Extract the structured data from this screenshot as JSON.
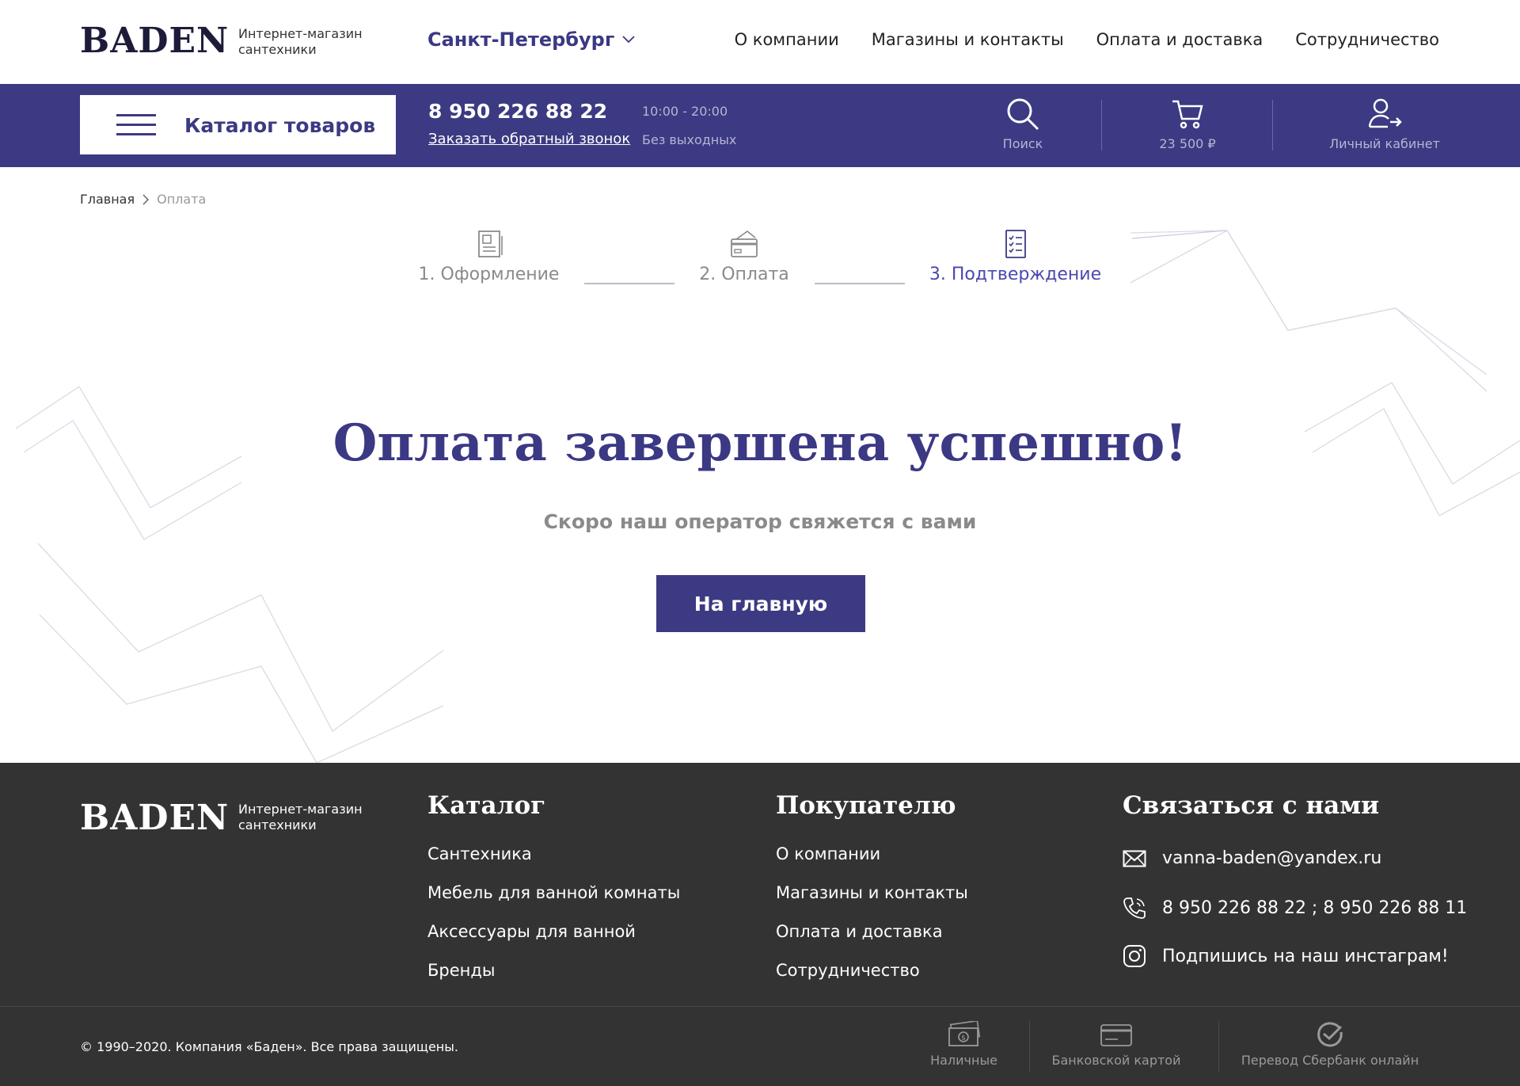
{
  "brand": {
    "logo": "BADEN",
    "tagline_line1": "Интернет-магазин",
    "tagline_line2": "сантехники",
    "primary_color": "#3c3a82",
    "footer_bg": "#333333"
  },
  "header": {
    "city": "Санкт-Петербург",
    "nav": [
      "О компании",
      "Магазины и контакты",
      "Оплата и доставка",
      "Сотрудничество"
    ]
  },
  "bluebar": {
    "catalog_label": "Каталог товаров",
    "phone": "8 950 226 88 22",
    "callback": "Заказать обратный звонок",
    "hours": "10:00 - 20:00",
    "days": "Без выходных",
    "search_label": "Поиск",
    "cart_label": "23 500 ₽",
    "account_label": "Личный кабинет"
  },
  "breadcrumb": {
    "home": "Главная",
    "current": "Оплата"
  },
  "steps": [
    {
      "label": "1. Оформление",
      "state": "done"
    },
    {
      "label": "2. Оплата",
      "state": "done"
    },
    {
      "label": "3. Подтверждение",
      "state": "active"
    }
  ],
  "result": {
    "title": "Оплата завершена успешно!",
    "subtitle": "Скоро наш оператор свяжется с вами",
    "button": "На главную"
  },
  "footer": {
    "catalog_title": "Каталог",
    "catalog_links": [
      "Сантехника",
      "Мебель для ванной комнаты",
      "Аксессуары для ванной",
      "Бренды"
    ],
    "buyer_title": "Покупателю",
    "buyer_links": [
      "О компании",
      "Магазины и контакты",
      "Оплата и доставка",
      "Сотрудничество"
    ],
    "contact_title": "Связаться с нами",
    "email": "vanna-baden@yandex.ru",
    "phones": "8 950 226 88 22 ; 8 950 226 88 11",
    "instagram": "Подпишись на наш инстаграм!",
    "copyright": "© 1990–2020. Компания «Баден». Все права защищены.",
    "payments": [
      "Наличные",
      "Банковской картой",
      "Перевод Сбербанк онлайн"
    ]
  }
}
